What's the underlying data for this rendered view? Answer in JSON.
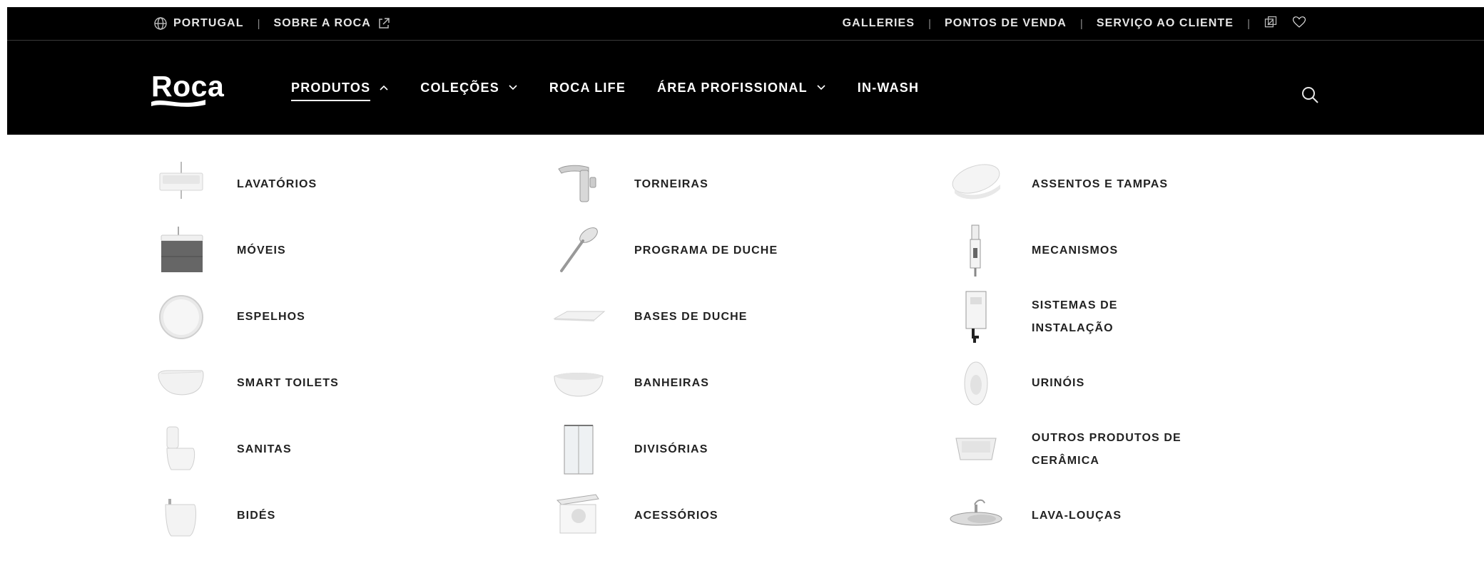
{
  "topbar": {
    "left": [
      {
        "label": "PORTUGAL",
        "icon": "globe-icon"
      },
      {
        "label": "SOBRE A ROCA",
        "icon": "external-link-icon"
      }
    ],
    "right": [
      {
        "label": "GALLERIES"
      },
      {
        "label": "PONTOS DE VENDA"
      },
      {
        "label": "SERVIÇO AO CLIENTE"
      }
    ],
    "right_icons": [
      "compare-icon",
      "heart-icon"
    ],
    "separator": "|"
  },
  "brand": {
    "name": "Roca"
  },
  "nav": {
    "items": [
      {
        "label": "PRODUTOS",
        "chevron": "up",
        "active": true
      },
      {
        "label": "COLEÇÕES",
        "chevron": "down"
      },
      {
        "label": "ROCA LIFE"
      },
      {
        "label": "ÁREA PROFISSIONAL",
        "chevron": "down"
      },
      {
        "label": "IN-WASH"
      }
    ],
    "search_icon": "search-icon"
  },
  "menu": {
    "columns": [
      [
        {
          "label": "LAVATÓRIOS",
          "icon": "washbasin-icon"
        },
        {
          "label": "MÓVEIS",
          "icon": "vanity-unit-icon"
        },
        {
          "label": "ESPELHOS",
          "icon": "round-mirror-icon"
        },
        {
          "label": "SMART TOILETS",
          "icon": "smart-toilet-icon"
        },
        {
          "label": "SANITAS",
          "icon": "toilet-icon"
        },
        {
          "label": "BIDÉS",
          "icon": "bidet-icon"
        }
      ],
      [
        {
          "label": "TORNEIRAS",
          "icon": "faucet-icon"
        },
        {
          "label": "PROGRAMA DE DUCHE",
          "icon": "hand-shower-icon"
        },
        {
          "label": "BASES DE DUCHE",
          "icon": "shower-tray-icon"
        },
        {
          "label": "BANHEIRAS",
          "icon": "bathtub-icon"
        },
        {
          "label": "DIVISÓRIAS",
          "icon": "shower-screen-icon"
        },
        {
          "label": "ACESSÓRIOS",
          "icon": "paper-holder-icon"
        }
      ],
      [
        {
          "label": "ASSENTOS E TAMPAS",
          "icon": "toilet-seat-icon"
        },
        {
          "label": "MECANISMOS",
          "icon": "flush-mechanism-icon"
        },
        {
          "label": "SISTEMAS DE INSTALAÇÃO",
          "icon": "installation-frame-icon"
        },
        {
          "label": "URINÓIS",
          "icon": "urinal-icon"
        },
        {
          "label": "OUTROS PRODUTOS DE CERÂMICA",
          "icon": "utility-sink-icon"
        },
        {
          "label": "LAVA-LOUÇAS",
          "icon": "kitchen-sink-icon"
        }
      ]
    ]
  },
  "colors": {
    "bar": "#000000",
    "text_light": "#ffffff",
    "menu_text": "#222222",
    "background": "#ffffff"
  }
}
